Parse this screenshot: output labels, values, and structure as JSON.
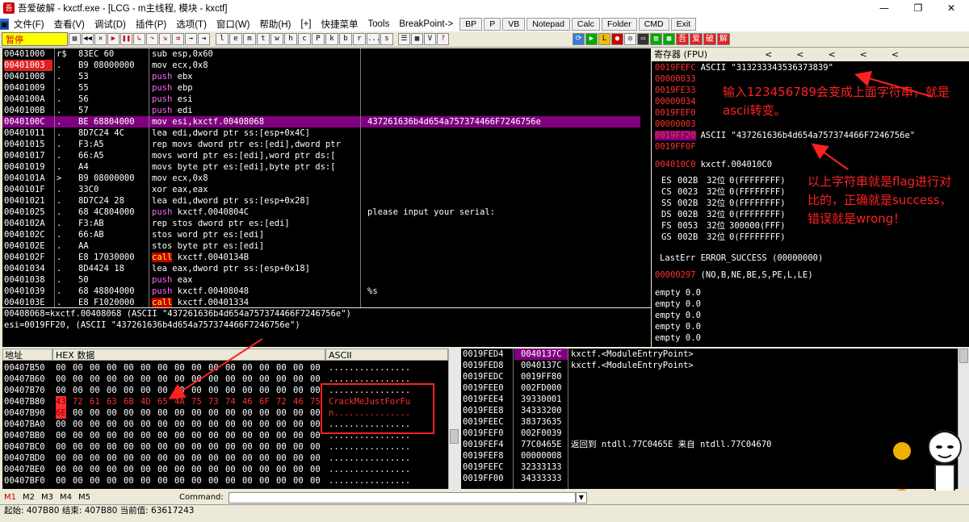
{
  "titlebar": {
    "title": "吾爱破解 - kxctf.exe - [LCG - m主线程, 模块 - kxctf]",
    "icon_name": "app-icon",
    "min": "—",
    "max": "❐",
    "close": "✕"
  },
  "menu": {
    "items": [
      "文件(F)",
      "查看(V)",
      "调试(D)",
      "插件(P)",
      "选项(T)",
      "窗口(W)",
      "帮助(H)",
      "[+]",
      "快捷菜单",
      "Tools",
      "BreakPoint->"
    ],
    "buttons": [
      "BP",
      "P",
      "VB",
      "Notepad",
      "Calc",
      "Folder",
      "CMD",
      "Exit"
    ]
  },
  "toolbar": {
    "status": "暂停",
    "letters": [
      "l",
      "e",
      "m",
      "t",
      "w",
      "h",
      "c",
      "P",
      "k",
      "b",
      "r",
      "...",
      "s"
    ],
    "cn_buttons": [
      "吾",
      "爱",
      "破",
      "解"
    ]
  },
  "disasm": {
    "rows": [
      {
        "addr": "00401000",
        "m": "r$",
        "hex": "83EC 60",
        "asm": [
          [
            "",
            "sub esp,0x60"
          ]
        ],
        "cm": ""
      },
      {
        "addr": "00401003",
        "m": ".",
        "hex": "B9 08000000",
        "asm": [
          [
            "",
            "mov ecx,0x8"
          ]
        ],
        "cm": "",
        "hl": true
      },
      {
        "addr": "00401008",
        "m": ".",
        "hex": "53",
        "asm": [
          [
            "kw",
            "push"
          ],
          [
            "",
            " ebx"
          ]
        ],
        "cm": ""
      },
      {
        "addr": "00401009",
        "m": ".",
        "hex": "55",
        "asm": [
          [
            "kw",
            "push"
          ],
          [
            "",
            " ebp"
          ]
        ],
        "cm": ""
      },
      {
        "addr": "0040100A",
        "m": ".",
        "hex": "56",
        "asm": [
          [
            "kw",
            "push"
          ],
          [
            "",
            " esi"
          ]
        ],
        "cm": ""
      },
      {
        "addr": "0040100B",
        "m": ".",
        "hex": "57",
        "asm": [
          [
            "kw",
            "push"
          ],
          [
            "",
            " edi"
          ]
        ],
        "cm": ""
      },
      {
        "addr": "0040100C",
        "m": ".",
        "hex": "BE 68804000",
        "asm": [
          [
            "",
            "mov esi,kxctf.00408068"
          ]
        ],
        "cm": "437261636b4d654a757374466F7246756e",
        "sel": true
      },
      {
        "addr": "00401011",
        "m": ".",
        "hex": "8D7C24 4C",
        "asm": [
          [
            "",
            "lea edi,dword ptr ss:[esp+0x4C]"
          ]
        ],
        "cm": ""
      },
      {
        "addr": "00401015",
        "m": ".",
        "hex": "F3:A5",
        "asm": [
          [
            "",
            "rep movs dword ptr es:[edi],dword ptr"
          ]
        ],
        "cm": ""
      },
      {
        "addr": "00401017",
        "m": ".",
        "hex": "66:A5",
        "asm": [
          [
            "",
            "movs word ptr es:[edi],word ptr ds:["
          ]
        ],
        "cm": ""
      },
      {
        "addr": "00401019",
        "m": ".",
        "hex": "A4",
        "asm": [
          [
            "",
            "movs byte ptr es:[edi],byte ptr ds:["
          ]
        ],
        "cm": ""
      },
      {
        "addr": "0040101A",
        "m": ">",
        "hex": "B9 08000000",
        "asm": [
          [
            "",
            "mov ecx,0x8"
          ]
        ],
        "cm": ""
      },
      {
        "addr": "0040101F",
        "m": ".",
        "hex": "33C0",
        "asm": [
          [
            "",
            "xor eax,eax"
          ]
        ],
        "cm": ""
      },
      {
        "addr": "00401021",
        "m": ".",
        "hex": "8D7C24 28",
        "asm": [
          [
            "",
            "lea edi,dword ptr ss:[esp+0x28]"
          ]
        ],
        "cm": ""
      },
      {
        "addr": "00401025",
        "m": ".",
        "hex": "68 4C804000",
        "asm": [
          [
            "kw",
            "push"
          ],
          [
            "",
            " kxctf.0040804C"
          ]
        ],
        "cm": "please input your serial:"
      },
      {
        "addr": "0040102A",
        "m": ".",
        "hex": "F3:AB",
        "asm": [
          [
            "",
            "rep stos dword ptr es:[edi]"
          ]
        ],
        "cm": ""
      },
      {
        "addr": "0040102C",
        "m": ".",
        "hex": "66:AB",
        "asm": [
          [
            "",
            "stos word ptr es:[edi]"
          ]
        ],
        "cm": ""
      },
      {
        "addr": "0040102E",
        "m": ".",
        "hex": "AA",
        "asm": [
          [
            "",
            "stos byte ptr es:[edi]"
          ]
        ],
        "cm": ""
      },
      {
        "addr": "0040102F",
        "m": ".",
        "hex": "E8 17030000",
        "asm": [
          [
            "call",
            "call"
          ],
          [
            "",
            " kxctf.0040134B"
          ]
        ],
        "cm": ""
      },
      {
        "addr": "00401034",
        "m": ".",
        "hex": "8D4424 18",
        "asm": [
          [
            "",
            "lea eax,dword ptr ss:[esp+0x18]"
          ]
        ],
        "cm": ""
      },
      {
        "addr": "00401038",
        "m": ".",
        "hex": "50",
        "asm": [
          [
            "kw",
            "push"
          ],
          [
            "",
            " eax"
          ]
        ],
        "cm": ""
      },
      {
        "addr": "00401039",
        "m": ".",
        "hex": "68 48804000",
        "asm": [
          [
            "kw",
            "push"
          ],
          [
            "",
            " kxctf.00408048"
          ]
        ],
        "cm": "%s"
      },
      {
        "addr": "0040103E",
        "m": ".",
        "hex": "E8 F1020000",
        "asm": [
          [
            "call",
            "call"
          ],
          [
            "",
            " kxctf.00401334"
          ]
        ],
        "cm": ""
      }
    ]
  },
  "info": {
    "line1": "00408068=kxctf.00408068 (ASCII \"437261636b4d654a757374466F7246756e\")",
    "line2": "esi=0019FF20, (ASCII \"437261636b4d654a757374466F7246756e\")"
  },
  "registers": {
    "title": "寄存器 (FPU)",
    "nav": [
      "<",
      "<",
      "<",
      "<",
      "<"
    ],
    "regs": [
      {
        "v": "0019FEFC",
        "t": "ASCII \"313233343536373839\""
      },
      {
        "v": "00000033",
        "t": ""
      },
      {
        "v": "0019FE33",
        "t": ""
      },
      {
        "v": "00000034",
        "t": ""
      },
      {
        "v": "0019FEF0",
        "t": ""
      },
      {
        "v": "00000003",
        "t": ""
      },
      {
        "v": "0019FF20",
        "t": "ASCII \"437261636b4d654a757374466F7246756e\"",
        "hl": true
      },
      {
        "v": "0019FF0F",
        "t": ""
      }
    ],
    "eip": {
      "v": "004010C0",
      "t": "kxctf.004010C0"
    },
    "segs": [
      {
        "n": "ES",
        "s": "002B",
        "b": "32位",
        "r": "0(FFFFFFFF)"
      },
      {
        "n": "CS",
        "s": "0023",
        "b": "32位",
        "r": "0(FFFFFFFF)"
      },
      {
        "n": "SS",
        "s": "002B",
        "b": "32位",
        "r": "0(FFFFFFFF)"
      },
      {
        "n": "DS",
        "s": "002B",
        "b": "32位",
        "r": "0(FFFFFFFF)"
      },
      {
        "n": "FS",
        "s": "0053",
        "b": "32位",
        "r": "300000(FFF)"
      },
      {
        "n": "GS",
        "s": "002B",
        "b": "32位",
        "r": "0(FFFFFFFF)"
      }
    ],
    "lasterr": "LastErr ERROR_SUCCESS (00000000)",
    "efl_val": "00000297",
    "efl_txt": "(NO,B,NE,BE,S,PE,L,LE)",
    "fpu": [
      "empty 0.0",
      "empty 0.0",
      "empty 0.0",
      "empty 0.0",
      "empty 0.0"
    ]
  },
  "annotations": {
    "note1": "输入123456789会变成上面字符串，就是ascii转变。",
    "note2": "以上字符串就是flag进行对比的，正确就是success，错误就是wrong！"
  },
  "dump": {
    "headers": {
      "addr": "地址",
      "hex": "HEX 数据",
      "ascii": "ASCII"
    },
    "rows": [
      {
        "addr": "00407B50",
        "hex": [
          "00",
          "00",
          "00",
          "00",
          "00",
          "00",
          "00",
          "00",
          "00",
          "00",
          "00",
          "00",
          "00",
          "00",
          "00",
          "00"
        ],
        "asc": "................"
      },
      {
        "addr": "00407B60",
        "hex": [
          "00",
          "00",
          "00",
          "00",
          "00",
          "00",
          "00",
          "00",
          "00",
          "00",
          "00",
          "00",
          "00",
          "00",
          "00",
          "00"
        ],
        "asc": "................"
      },
      {
        "addr": "00407B70",
        "hex": [
          "00",
          "00",
          "00",
          "00",
          "00",
          "00",
          "00",
          "00",
          "00",
          "00",
          "00",
          "00",
          "00",
          "00",
          "00",
          "00"
        ],
        "asc": "................"
      },
      {
        "addr": "00407B80",
        "hex": [
          "43",
          "72",
          "61",
          "63",
          "6B",
          "4D",
          "65",
          "4A",
          "75",
          "73",
          "74",
          "46",
          "6F",
          "72",
          "46",
          "75"
        ],
        "asc": "CrackMeJustForFu",
        "red": true
      },
      {
        "addr": "00407B90",
        "hex": [
          "6E",
          "00",
          "00",
          "00",
          "00",
          "00",
          "00",
          "00",
          "00",
          "00",
          "00",
          "00",
          "00",
          "00",
          "00",
          "00"
        ],
        "asc": "n...............",
        "first_red": true
      },
      {
        "addr": "00407BA0",
        "hex": [
          "00",
          "00",
          "00",
          "00",
          "00",
          "00",
          "00",
          "00",
          "00",
          "00",
          "00",
          "00",
          "00",
          "00",
          "00",
          "00"
        ],
        "asc": "................"
      },
      {
        "addr": "00407BB0",
        "hex": [
          "00",
          "00",
          "00",
          "00",
          "00",
          "00",
          "00",
          "00",
          "00",
          "00",
          "00",
          "00",
          "00",
          "00",
          "00",
          "00"
        ],
        "asc": "................"
      },
      {
        "addr": "00407BC0",
        "hex": [
          "00",
          "00",
          "00",
          "00",
          "00",
          "00",
          "00",
          "00",
          "00",
          "00",
          "00",
          "00",
          "00",
          "00",
          "00",
          "00"
        ],
        "asc": "................"
      },
      {
        "addr": "00407BD0",
        "hex": [
          "00",
          "00",
          "00",
          "00",
          "00",
          "00",
          "00",
          "00",
          "00",
          "00",
          "00",
          "00",
          "00",
          "00",
          "00",
          "00"
        ],
        "asc": "................"
      },
      {
        "addr": "00407BE0",
        "hex": [
          "00",
          "00",
          "00",
          "00",
          "00",
          "00",
          "00",
          "00",
          "00",
          "00",
          "00",
          "00",
          "00",
          "00",
          "00",
          "00"
        ],
        "asc": "................"
      },
      {
        "addr": "00407BF0",
        "hex": [
          "00",
          "00",
          "00",
          "00",
          "00",
          "00",
          "00",
          "00",
          "00",
          "00",
          "00",
          "00",
          "00",
          "00",
          "00",
          "00"
        ],
        "asc": "................"
      }
    ]
  },
  "stack": {
    "rows": [
      {
        "a": "0019FED4",
        "v": "0040137C",
        "c": "kxctf.<ModuleEntryPoint>",
        "sel": true
      },
      {
        "a": "0019FED8",
        "v": "0040137C",
        "c": "kxctf.<ModuleEntryPoint>"
      },
      {
        "a": "0019FEDC",
        "v": "0019FF80",
        "c": ""
      },
      {
        "a": "0019FEE0",
        "v": "002FD000",
        "c": ""
      },
      {
        "a": "0019FEE4",
        "v": "39330001",
        "c": ""
      },
      {
        "a": "0019FEE8",
        "v": "34333200",
        "c": ""
      },
      {
        "a": "0019FEEC",
        "v": "38373635",
        "c": ""
      },
      {
        "a": "0019FEF0",
        "v": "002F0039",
        "c": ""
      },
      {
        "a": "0019FEF4",
        "v": "77C0465E",
        "c": "返回到 ntdll.77C0465E 来自 ntdll.77C04670"
      },
      {
        "a": "0019FEF8",
        "v": "00000008",
        "c": ""
      },
      {
        "a": "0019FEFC",
        "v": "32333133",
        "c": ""
      },
      {
        "a": "0019FF00",
        "v": "34333333",
        "c": ""
      }
    ]
  },
  "cmdbar": {
    "tabs": [
      "M1",
      "M2",
      "M3",
      "M4",
      "M5"
    ],
    "label": "Command:",
    "value": ""
  },
  "status": {
    "text": "起始: 407B80 结束: 407B80 当前值: 63617243"
  },
  "colors": {
    "accent_red": "#ff2020",
    "select_purple": "#800080",
    "pane_bg": "#000000"
  }
}
